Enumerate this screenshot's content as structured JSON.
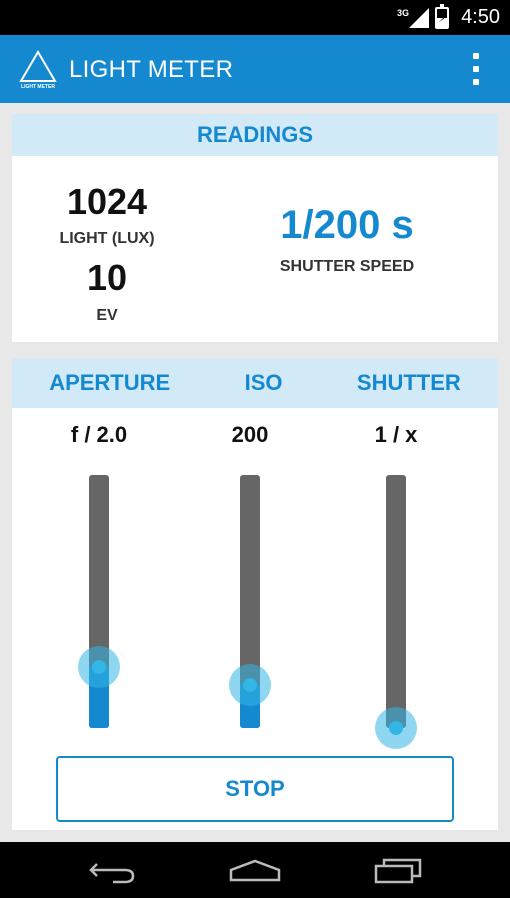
{
  "status_bar": {
    "network": "3G",
    "time": "4:50"
  },
  "app_bar": {
    "logo_text": "LIGHT METER",
    "title": "LIGHT METER"
  },
  "readings": {
    "header": "READINGS",
    "lux_value": "1024",
    "lux_label": "LIGHT (LUX)",
    "ev_value": "10",
    "ev_label": "EV",
    "shutter_value": "1/200 s",
    "shutter_label": "SHUTTER SPEED"
  },
  "controls": {
    "aperture": {
      "header": "APERTURE",
      "value": "f / 2.0",
      "level": 0.24
    },
    "iso": {
      "header": "ISO",
      "value": "200",
      "level": 0.17
    },
    "shutter": {
      "header": "SHUTTER",
      "value": "1 / x",
      "level": 0.0
    }
  },
  "stop_button": {
    "label": "STOP"
  },
  "colors": {
    "accent": "#1589cf",
    "header_bg": "#d2e9f7",
    "thumb": "#33b5e5",
    "track": "#666666"
  },
  "icons": {
    "overflow": "overflow-menu-icon",
    "back": "back-icon",
    "home": "home-icon",
    "recent": "recent-apps-icon"
  }
}
